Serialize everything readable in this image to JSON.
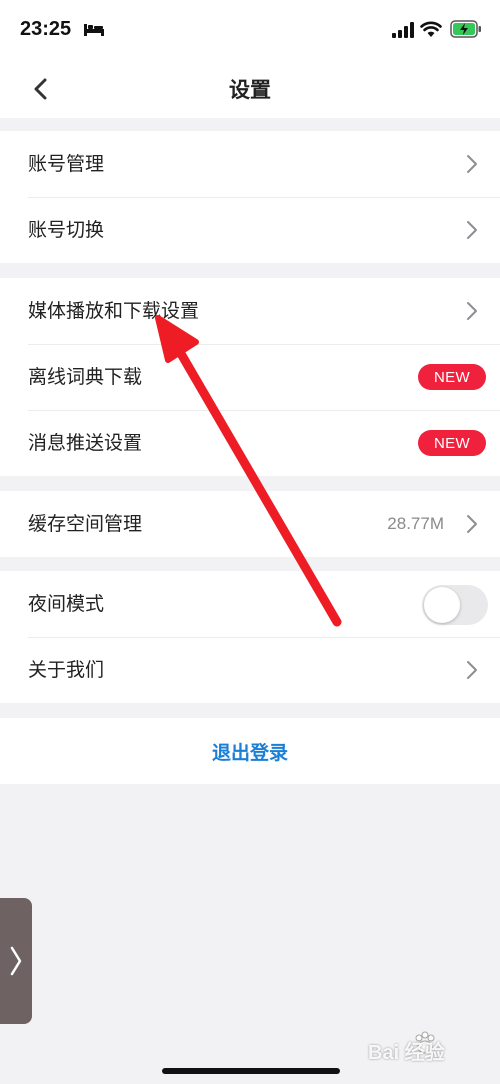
{
  "status_bar": {
    "time": "23:25",
    "icons": [
      "bed-icon",
      "signal-icon",
      "wifi-icon",
      "battery-charging-icon"
    ]
  },
  "nav": {
    "title": "设置",
    "back_icon": "chevron-left-icon"
  },
  "groups": [
    {
      "rows": [
        {
          "label": "账号管理",
          "trailing": "chevron-right-icon"
        },
        {
          "label": "账号切换",
          "trailing": "chevron-right-icon"
        }
      ]
    },
    {
      "rows": [
        {
          "label": "媒体播放和下载设置",
          "trailing": "chevron-right-icon"
        },
        {
          "label": "离线词典下载",
          "badge": "NEW"
        },
        {
          "label": "消息推送设置",
          "badge": "NEW"
        }
      ]
    },
    {
      "rows": [
        {
          "label": "缓存空间管理",
          "value": "28.77M",
          "trailing": "chevron-right-icon"
        }
      ]
    },
    {
      "rows": [
        {
          "label": "夜间模式",
          "toggle": false
        },
        {
          "label": "关于我们",
          "trailing": "chevron-right-icon"
        }
      ]
    }
  ],
  "logout": {
    "label": "退出登录"
  },
  "side_tab": {
    "icon": "chevron-right-icon"
  },
  "watermark": {
    "text": "Bai 经验",
    "icon": "paw-icon"
  },
  "annotation": {
    "icon": "red-arrow-icon",
    "color": "#ee1c25"
  },
  "colors": {
    "badge": "#f0213c",
    "logout": "#1a7fd6",
    "background": "#f2f2f4"
  }
}
